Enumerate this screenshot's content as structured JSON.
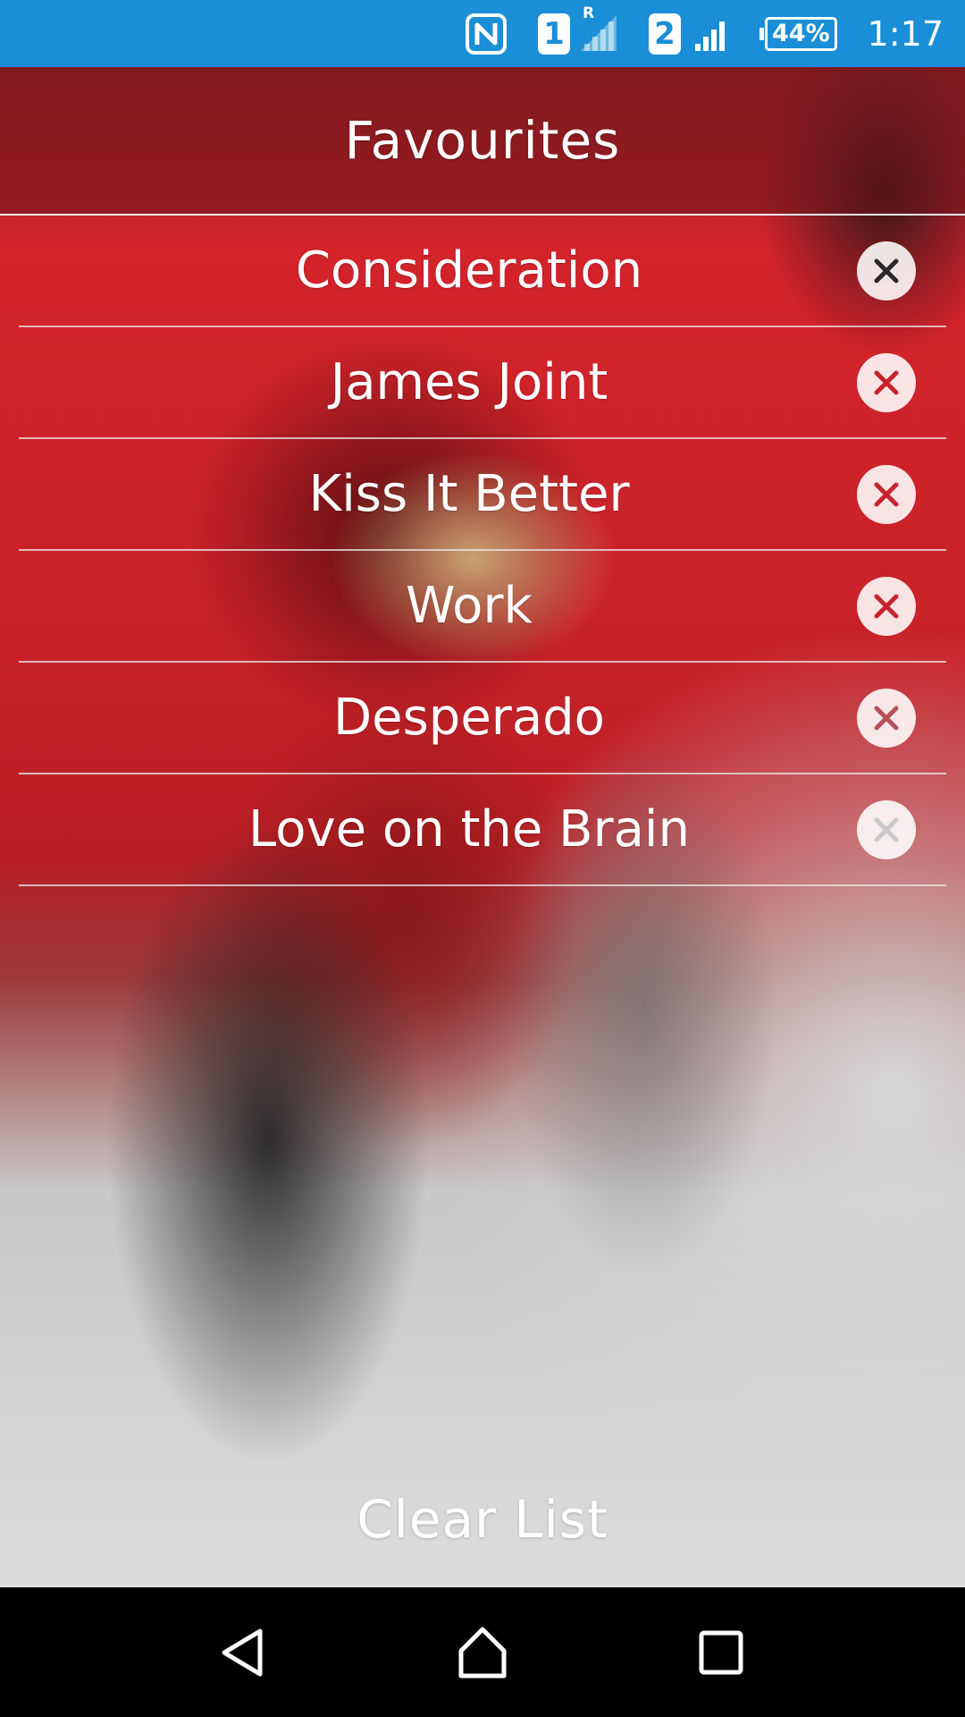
{
  "status_bar": {
    "icons": [
      "nfc-icon",
      "sim-1-icon",
      "signal-roaming-icon",
      "sim-2-icon",
      "signal-icon",
      "battery-icon"
    ],
    "sim1_label": "1",
    "roaming_flag": "R",
    "sim2_label": "2",
    "battery_percent": "44%",
    "battery_level": 0.44,
    "time": "1:17",
    "background_color": "#1a8ed6"
  },
  "header": {
    "title": "Favourites"
  },
  "favourites": [
    {
      "title": "Consideration",
      "remove_icon": "close-icon",
      "remove_color": "#2a2a2a"
    },
    {
      "title": "James Joint",
      "remove_icon": "close-icon",
      "remove_color": "#c8232d"
    },
    {
      "title": "Kiss It Better",
      "remove_icon": "close-icon",
      "remove_color": "#c8232d"
    },
    {
      "title": "Work",
      "remove_icon": "close-icon",
      "remove_color": "#c8232d"
    },
    {
      "title": "Desperado",
      "remove_icon": "close-icon",
      "remove_color": "#b7505a"
    },
    {
      "title": "Love on the Brain",
      "remove_icon": "close-icon",
      "remove_color": "#c9c9c9"
    }
  ],
  "actions": {
    "clear_label": "Clear List"
  },
  "nav_bar": {
    "back_icon": "back-triangle-icon",
    "home_icon": "home-icon",
    "recents_icon": "recents-square-icon"
  },
  "colors": {
    "accent_red": "#d3232b",
    "divider": "#ebebeb",
    "text": "#ffffff"
  }
}
